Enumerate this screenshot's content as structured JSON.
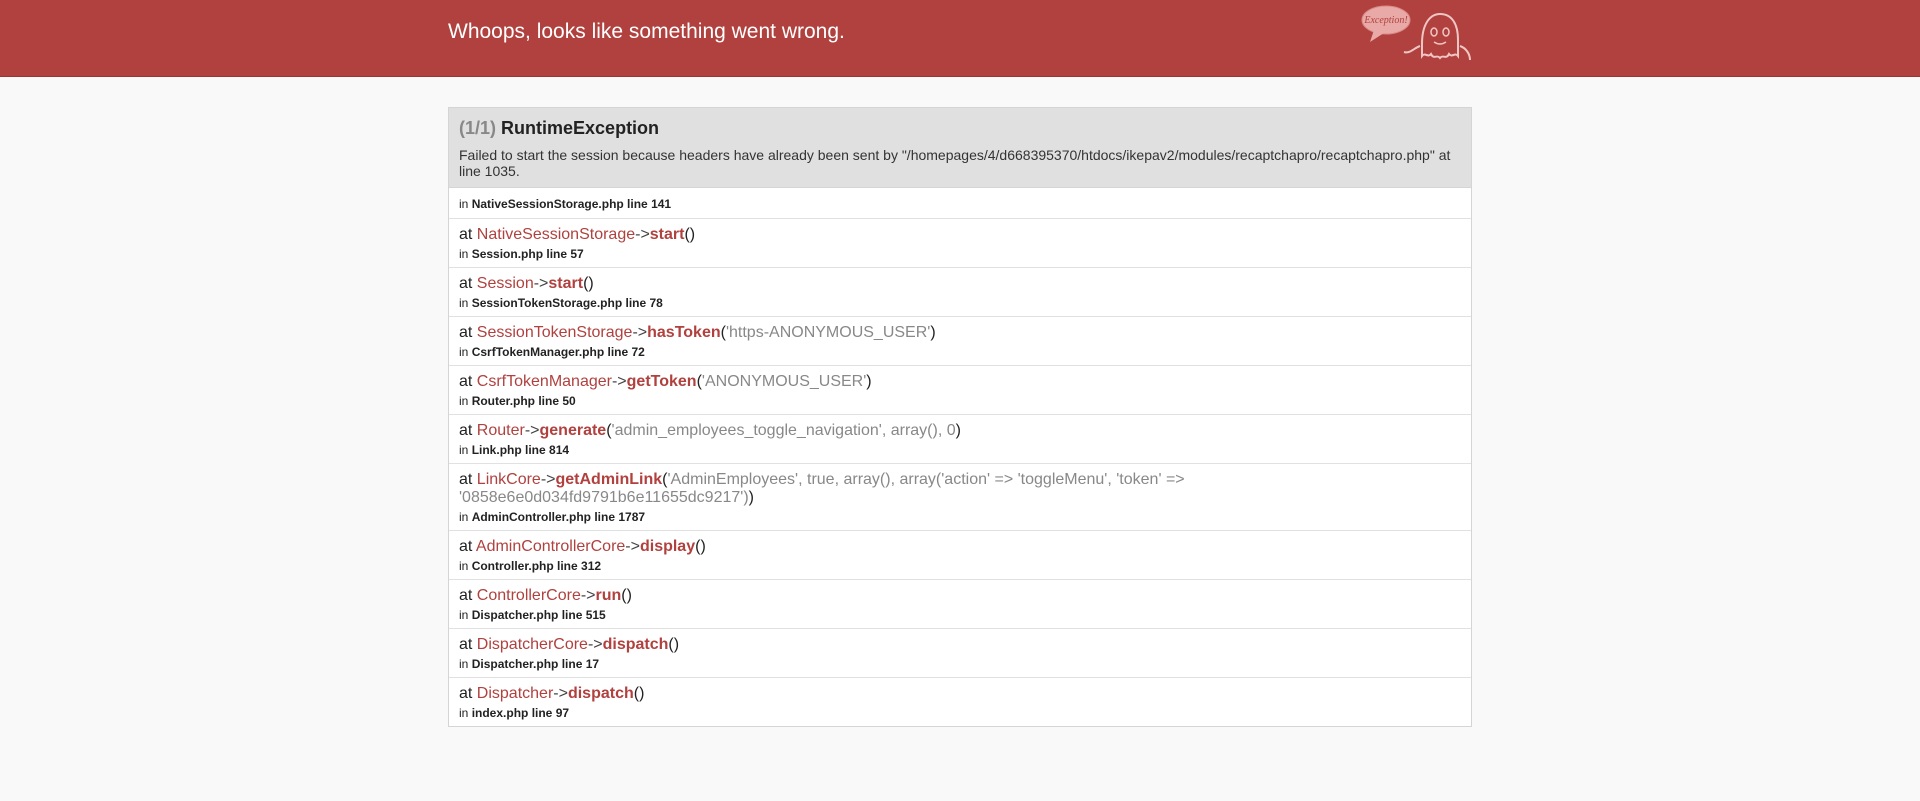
{
  "header": {
    "title": "Whoops, looks like something went wrong.",
    "logo_text": "Exception!"
  },
  "exception": {
    "count": "(1/1)",
    "name": "RuntimeException",
    "message": "Failed to start the session because headers have already been sent by \"/homepages/4/d668395370/htdocs/ikepav2/modules/recaptchapro/recaptchapro.php\" at line 1035."
  },
  "trace": {
    "first_location": {
      "in": "in",
      "file": "NativeSessionStorage.php line 141"
    },
    "frames": [
      {
        "at": "at",
        "class": "NativeSessionStorage",
        "arrow": "->",
        "method": "start",
        "args_open": "(",
        "args": "",
        "args_close": ")",
        "in": "in",
        "location": "Session.php line 57"
      },
      {
        "at": "at",
        "class": "Session",
        "arrow": "->",
        "method": "start",
        "args_open": "(",
        "args": "",
        "args_close": ")",
        "in": "in",
        "location": "SessionTokenStorage.php line 78"
      },
      {
        "at": "at",
        "class": "SessionTokenStorage",
        "arrow": "->",
        "method": "hasToken",
        "args_open": "(",
        "args": "'https-ANONYMOUS_USER'",
        "args_close": ")",
        "in": "in",
        "location": "CsrfTokenManager.php line 72"
      },
      {
        "at": "at",
        "class": "CsrfTokenManager",
        "arrow": "->",
        "method": "getToken",
        "args_open": "(",
        "args": "'ANONYMOUS_USER'",
        "args_close": ")",
        "in": "in",
        "location": "Router.php line 50"
      },
      {
        "at": "at",
        "class": "Router",
        "arrow": "->",
        "method": "generate",
        "args_open": "(",
        "args": "'admin_employees_toggle_navigation', array(), 0",
        "args_close": ")",
        "in": "in",
        "location": "Link.php line 814"
      },
      {
        "at": "at",
        "class": "LinkCore",
        "arrow": "->",
        "method": "getAdminLink",
        "args_open": "(",
        "args": "'AdminEmployees', true, array(), array('action' => 'toggleMenu', 'token' => '0858e6e0d034fd9791b6e11655dc9217')",
        "args_close": ")",
        "in": "in",
        "location": "AdminController.php line 1787"
      },
      {
        "at": "at",
        "class": "AdminControllerCore",
        "arrow": "->",
        "method": "display",
        "args_open": "(",
        "args": "",
        "args_close": ")",
        "in": "in",
        "location": "Controller.php line 312"
      },
      {
        "at": "at",
        "class": "ControllerCore",
        "arrow": "->",
        "method": "run",
        "args_open": "(",
        "args": "",
        "args_close": ")",
        "in": "in",
        "location": "Dispatcher.php line 515"
      },
      {
        "at": "at",
        "class": "DispatcherCore",
        "arrow": "->",
        "method": "dispatch",
        "args_open": "(",
        "args": "",
        "args_close": ")",
        "in": "in",
        "location": "Dispatcher.php line 17"
      },
      {
        "at": "at",
        "class": "Dispatcher",
        "arrow": "->",
        "method": "dispatch",
        "args_open": "(",
        "args": "",
        "args_close": ")",
        "in": "in",
        "location": "index.php line 97"
      }
    ]
  },
  "colors": {
    "header_bg": "#b0413e",
    "accent": "#b0413e",
    "panel_head_bg": "#e0e0e0"
  }
}
